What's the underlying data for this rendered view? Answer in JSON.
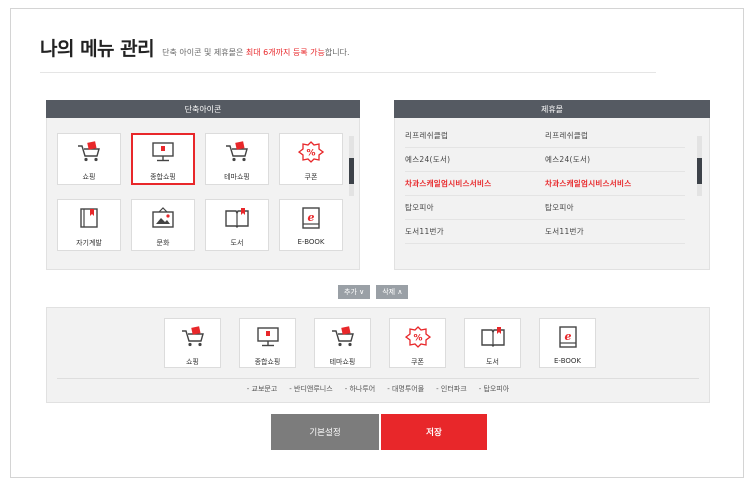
{
  "header": {
    "title": "나의 메뉴 관리",
    "subtitle_pre": "단축 아이콘 및 제휴몰은 ",
    "subtitle_highlight": "최대 6개까지 등록 가능",
    "subtitle_post": "합니다."
  },
  "shortcut_panel": {
    "heading": "단축아이콘",
    "items": [
      {
        "label": "쇼핑",
        "icon": "cart-icon"
      },
      {
        "label": "종합쇼핑",
        "icon": "monitor-icon",
        "selected": true
      },
      {
        "label": "테마쇼핑",
        "icon": "cart-icon"
      },
      {
        "label": "쿠폰",
        "icon": "coupon-icon"
      },
      {
        "label": "자기계발",
        "icon": "bookmark-book-icon"
      },
      {
        "label": "문화",
        "icon": "picture-icon"
      },
      {
        "label": "도서",
        "icon": "open-book-icon"
      },
      {
        "label": "E-BOOK",
        "icon": "ebook-icon"
      }
    ]
  },
  "partner_panel": {
    "heading": "제휴몰",
    "rows": [
      [
        "리프레쉬클럽",
        "리프레쉬클럽"
      ],
      [
        "예스24(도서)",
        "예스24(도서)"
      ],
      [
        "차과스캐일엄시비스서비스",
        "차과스캐일엄시비스서비스"
      ],
      [
        "탑오피아",
        "탑오피아"
      ],
      [
        "도서11번가",
        "도서11번가"
      ]
    ],
    "highlight_row": 2
  },
  "actions": {
    "add_label": "추가 ∨",
    "remove_label": "삭제 ∧"
  },
  "my_menu": {
    "items": [
      {
        "label": "쇼핑",
        "icon": "cart-icon"
      },
      {
        "label": "종합쇼핑",
        "icon": "monitor-icon"
      },
      {
        "label": "테마쇼핑",
        "icon": "cart-icon"
      },
      {
        "label": "쿠폰",
        "icon": "coupon-icon"
      },
      {
        "label": "도서",
        "icon": "open-book-icon"
      },
      {
        "label": "E-BOOK",
        "icon": "ebook-icon"
      }
    ],
    "links": [
      "- 교보문고",
      "- 반디앤루니스",
      "- 하나투어",
      "- 대명투어몰",
      "- 인터파크",
      "- 탑오피아"
    ]
  },
  "footer": {
    "default_label": "기본설정",
    "save_label": "저장"
  },
  "colors": {
    "accent": "#e8272a",
    "panel_header": "#555a62"
  }
}
